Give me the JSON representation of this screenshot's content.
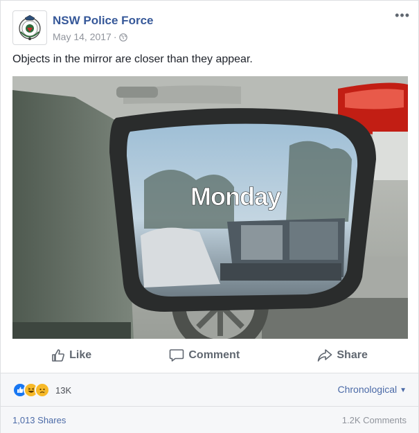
{
  "post": {
    "page_name": "NSW Police Force",
    "date": "May 14, 2017",
    "separator": "·",
    "text": "Objects in the mirror are closer than they appear."
  },
  "image": {
    "overlay_text": "Monday"
  },
  "actions": {
    "like": "Like",
    "comment": "Comment",
    "share": "Share"
  },
  "reactions": {
    "types": [
      "like",
      "haha",
      "sad"
    ],
    "count": "13K"
  },
  "sort": {
    "label": "Chronological"
  },
  "footer": {
    "shares": "1,013 Shares",
    "comments": "1.2K Comments"
  },
  "colors": {
    "link": "#365899",
    "secondary_text": "#90949c",
    "like_blue": "#1877f2",
    "haha_yellow": "#f7b928"
  }
}
